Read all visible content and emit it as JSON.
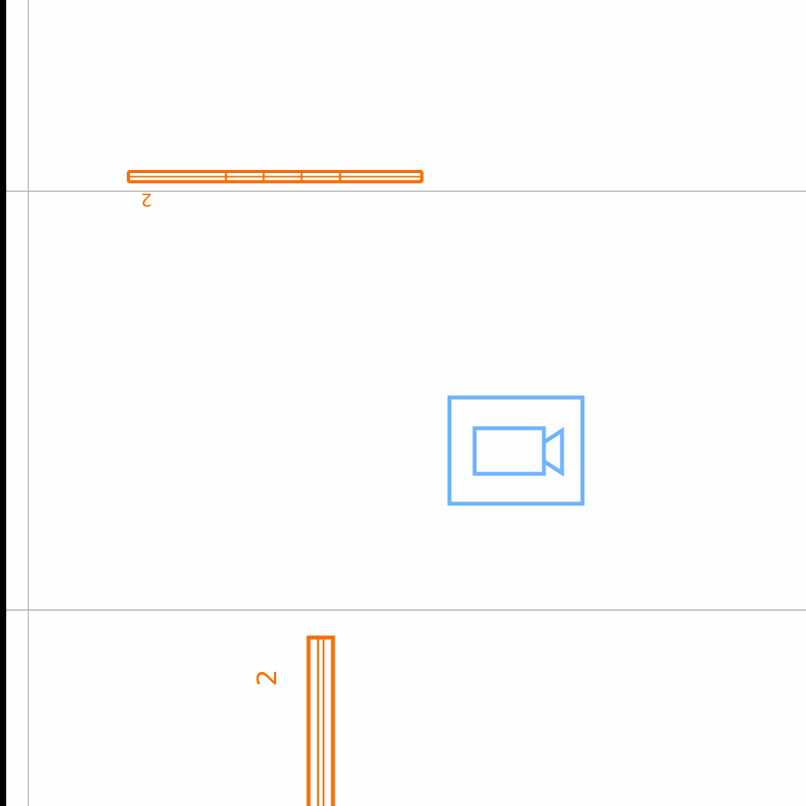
{
  "colors": {
    "background": "#fefefe",
    "left_bar": "#000000",
    "grid_line": "#b4b4b4",
    "window_symbol": "#ff6e00",
    "camera_symbol": "#6eb4ff"
  },
  "labels": {
    "window_top": "2",
    "window_bottom": "2"
  },
  "icons": {
    "camera": "camera-icon"
  }
}
